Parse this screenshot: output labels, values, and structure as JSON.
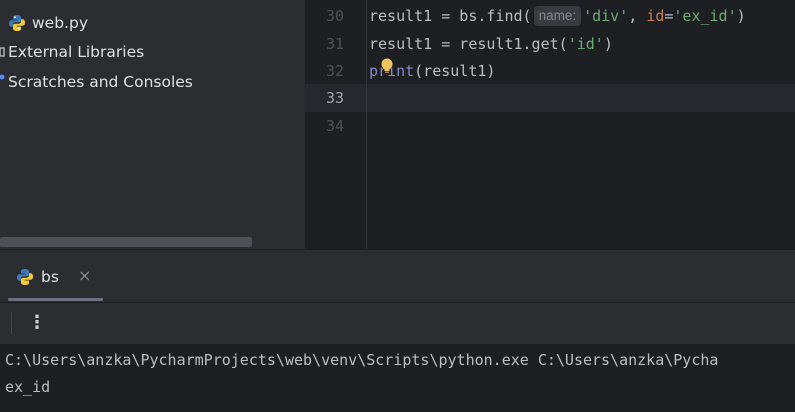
{
  "project_tree": {
    "items": [
      {
        "label": "web.py",
        "icon": "python-file-icon"
      },
      {
        "label": "External Libraries",
        "icon": "library-icon"
      },
      {
        "label": "Scratches and Consoles",
        "icon": "scratches-icon"
      }
    ]
  },
  "editor": {
    "line_numbers": [
      "30",
      "31",
      "32",
      "33",
      "34"
    ],
    "current_line": "33",
    "lines": {
      "l30": {
        "prefix": "result1 = bs.find(",
        "hint": "name:",
        "arg1": "'div'",
        "comma": ", ",
        "kw": "id",
        "eq": "=",
        "arg2": "'ex_id'",
        "suffix": ")"
      },
      "l31": {
        "prefix": "result1 = result1.get(",
        "arg": "'id'",
        "suffix": ")"
      },
      "l32": {
        "builtin": "print",
        "suffix": "(result1)"
      }
    }
  },
  "run_window": {
    "tab_label": "bs",
    "tab_icon": "python-icon",
    "close_label": "×",
    "more_label": "⋮",
    "console": [
      "C:\\Users\\anzka\\PycharmProjects\\web\\venv\\Scripts\\python.exe C:\\Users\\anzka\\Pycha",
      "ex_id"
    ]
  },
  "colors": {
    "background": "#2b2d30",
    "editor_background": "#1e1f22",
    "string": "#6aab73",
    "keyword_arg": "#c77d55",
    "builtin": "#8888c6",
    "bulb": "#f2c55c"
  }
}
